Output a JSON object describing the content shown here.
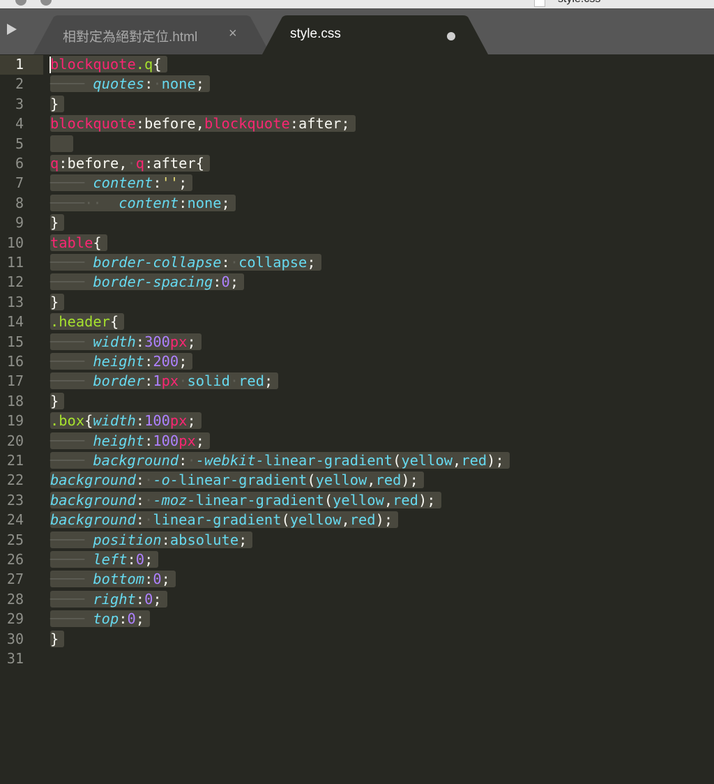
{
  "window": {
    "title": "style.css"
  },
  "tabs": [
    {
      "label": "相對定為絕對定位.html",
      "close_glyph": "×",
      "active": false
    },
    {
      "label": "style.css",
      "active": true,
      "dirty": true
    }
  ],
  "editor": {
    "current_line": 1,
    "lines": [
      {
        "n": "1",
        "code": [
          [
            "k",
            "blockquote"
          ],
          [
            "c",
            ".q"
          ],
          [
            "w",
            "{"
          ]
        ]
      },
      {
        "n": "2",
        "code": [
          [
            "ws",
            "──── "
          ],
          [
            "p",
            "quotes"
          ],
          [
            "w",
            ":"
          ],
          [
            "ws",
            "·"
          ],
          [
            "v",
            "none"
          ],
          [
            "w",
            ";"
          ]
        ]
      },
      {
        "n": "3",
        "code": [
          [
            "w",
            "}"
          ]
        ]
      },
      {
        "n": "4",
        "code": [
          [
            "k",
            "blockquote"
          ],
          [
            "w",
            ":before,"
          ],
          [
            "k",
            "blockquote"
          ],
          [
            "w",
            ":after;"
          ]
        ]
      },
      {
        "n": "5",
        "code": [
          [
            "w",
            "  "
          ]
        ]
      },
      {
        "n": "6",
        "code": [
          [
            "k",
            "q"
          ],
          [
            "w",
            ":before,"
          ],
          [
            "ws",
            "·"
          ],
          [
            "k",
            "q"
          ],
          [
            "w",
            ":after{"
          ]
        ]
      },
      {
        "n": "7",
        "code": [
          [
            "ws",
            "──── "
          ],
          [
            "p",
            "content"
          ],
          [
            "w",
            ":"
          ],
          [
            "s",
            "''"
          ],
          [
            "w",
            ";"
          ]
        ]
      },
      {
        "n": "8",
        "code": [
          [
            "ws",
            "────··  "
          ],
          [
            "p",
            "content"
          ],
          [
            "w",
            ":"
          ],
          [
            "v",
            "none"
          ],
          [
            "w",
            ";"
          ]
        ]
      },
      {
        "n": "9",
        "code": [
          [
            "w",
            "}"
          ]
        ]
      },
      {
        "n": "10",
        "code": [
          [
            "k",
            "table"
          ],
          [
            "w",
            "{"
          ]
        ]
      },
      {
        "n": "11",
        "code": [
          [
            "ws",
            "──── "
          ],
          [
            "p",
            "border-collapse"
          ],
          [
            "w",
            ":"
          ],
          [
            "ws",
            "·"
          ],
          [
            "v",
            "collapse"
          ],
          [
            "w",
            ";"
          ]
        ]
      },
      {
        "n": "12",
        "code": [
          [
            "ws",
            "──── "
          ],
          [
            "p",
            "border-spacing"
          ],
          [
            "w",
            ":"
          ],
          [
            "n",
            "0"
          ],
          [
            "w",
            ";"
          ]
        ]
      },
      {
        "n": "13",
        "code": [
          [
            "w",
            "}"
          ]
        ]
      },
      {
        "n": "14",
        "code": [
          [
            "c",
            ".header"
          ],
          [
            "w",
            "{"
          ]
        ]
      },
      {
        "n": "15",
        "code": [
          [
            "ws",
            "──── "
          ],
          [
            "p",
            "width"
          ],
          [
            "w",
            ":"
          ],
          [
            "n",
            "300"
          ],
          [
            "k",
            "px"
          ],
          [
            "w",
            ";"
          ]
        ]
      },
      {
        "n": "16",
        "code": [
          [
            "ws",
            "──── "
          ],
          [
            "p",
            "height"
          ],
          [
            "w",
            ":"
          ],
          [
            "n",
            "200"
          ],
          [
            "w",
            ";"
          ]
        ]
      },
      {
        "n": "17",
        "code": [
          [
            "ws",
            "──── "
          ],
          [
            "p",
            "border"
          ],
          [
            "w",
            ":"
          ],
          [
            "n",
            "1"
          ],
          [
            "k",
            "px"
          ],
          [
            "ws",
            "·"
          ],
          [
            "v",
            "solid"
          ],
          [
            "ws",
            "·"
          ],
          [
            "v",
            "red"
          ],
          [
            "w",
            ";"
          ]
        ]
      },
      {
        "n": "18",
        "code": [
          [
            "w",
            "}"
          ]
        ]
      },
      {
        "n": "19",
        "code": [
          [
            "c",
            ".box"
          ],
          [
            "w",
            "{"
          ],
          [
            "p",
            "width"
          ],
          [
            "w",
            ":"
          ],
          [
            "n",
            "100"
          ],
          [
            "k",
            "px"
          ],
          [
            "w",
            ";"
          ]
        ]
      },
      {
        "n": "20",
        "code": [
          [
            "ws",
            "──── "
          ],
          [
            "p",
            "height"
          ],
          [
            "w",
            ":"
          ],
          [
            "n",
            "100"
          ],
          [
            "k",
            "px"
          ],
          [
            "w",
            ";"
          ]
        ]
      },
      {
        "n": "21",
        "code": [
          [
            "ws",
            "──── "
          ],
          [
            "p",
            "background"
          ],
          [
            "w",
            ":"
          ],
          [
            "ws",
            "·"
          ],
          [
            "p",
            "-webkit-"
          ],
          [
            "v",
            "linear-gradient"
          ],
          [
            "w",
            "("
          ],
          [
            "v",
            "yellow"
          ],
          [
            "w",
            ","
          ],
          [
            "v",
            "red"
          ],
          [
            "w",
            ");"
          ]
        ]
      },
      {
        "n": "22",
        "code": [
          [
            "p",
            "background"
          ],
          [
            "w",
            ":"
          ],
          [
            "ws",
            "·"
          ],
          [
            "p",
            "-o-"
          ],
          [
            "v",
            "linear-gradient"
          ],
          [
            "w",
            "("
          ],
          [
            "v",
            "yellow"
          ],
          [
            "w",
            ","
          ],
          [
            "v",
            "red"
          ],
          [
            "w",
            ");"
          ]
        ]
      },
      {
        "n": "23",
        "code": [
          [
            "p",
            "background"
          ],
          [
            "w",
            ":"
          ],
          [
            "ws",
            "·"
          ],
          [
            "p",
            "-moz-"
          ],
          [
            "v",
            "linear-gradient"
          ],
          [
            "w",
            "("
          ],
          [
            "v",
            "yellow"
          ],
          [
            "w",
            ","
          ],
          [
            "v",
            "red"
          ],
          [
            "w",
            ");"
          ]
        ]
      },
      {
        "n": "24",
        "code": [
          [
            "p",
            "background"
          ],
          [
            "w",
            ":"
          ],
          [
            "ws",
            "·"
          ],
          [
            "v",
            "linear-gradient"
          ],
          [
            "w",
            "("
          ],
          [
            "v",
            "yellow"
          ],
          [
            "w",
            ","
          ],
          [
            "v",
            "red"
          ],
          [
            "w",
            ");"
          ]
        ]
      },
      {
        "n": "25",
        "code": [
          [
            "ws",
            "──── "
          ],
          [
            "p",
            "position"
          ],
          [
            "w",
            ":"
          ],
          [
            "v",
            "absolute"
          ],
          [
            "w",
            ";"
          ]
        ]
      },
      {
        "n": "26",
        "code": [
          [
            "ws",
            "──── "
          ],
          [
            "p",
            "left"
          ],
          [
            "w",
            ":"
          ],
          [
            "n",
            "0"
          ],
          [
            "w",
            ";"
          ]
        ]
      },
      {
        "n": "27",
        "code": [
          [
            "ws",
            "──── "
          ],
          [
            "p",
            "bottom"
          ],
          [
            "w",
            ":"
          ],
          [
            "n",
            "0"
          ],
          [
            "w",
            ";"
          ]
        ]
      },
      {
        "n": "28",
        "code": [
          [
            "ws",
            "──── "
          ],
          [
            "p",
            "right"
          ],
          [
            "w",
            ":"
          ],
          [
            "n",
            "0"
          ],
          [
            "w",
            ";"
          ]
        ]
      },
      {
        "n": "29",
        "code": [
          [
            "ws",
            "──── "
          ],
          [
            "p",
            "top"
          ],
          [
            "w",
            ":"
          ],
          [
            "n",
            "0"
          ],
          [
            "w",
            ";"
          ]
        ]
      },
      {
        "n": "30",
        "code": [
          [
            "w",
            "}"
          ]
        ]
      },
      {
        "n": "31",
        "code": []
      }
    ]
  },
  "colors": {
    "background": "#272822",
    "keyword": "#f92672",
    "property": "#66d9ef",
    "number": "#ae81ff",
    "class": "#a6e22e",
    "string": "#e6db74",
    "text": "#f8f8f2",
    "selection": "#49483e",
    "tabbar": "#575757"
  }
}
